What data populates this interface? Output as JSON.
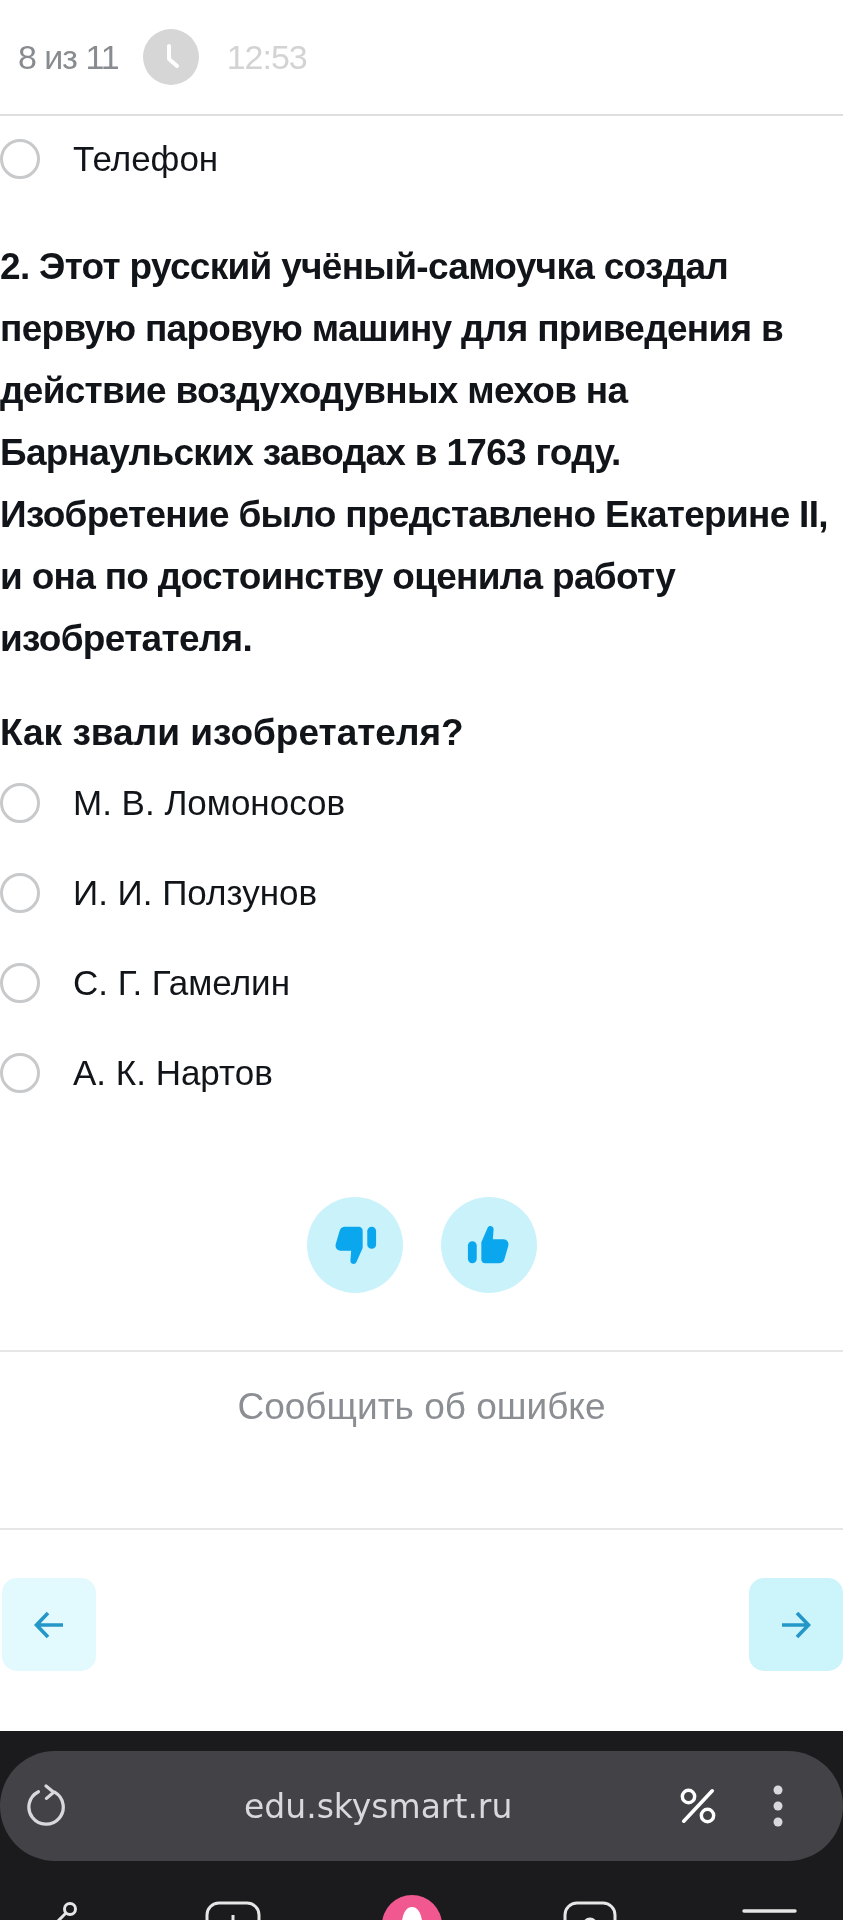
{
  "header": {
    "progress": "8 из 11",
    "timer": "12:53"
  },
  "previous_options": [
    {
      "label": "Телефон",
      "selected": false
    }
  ],
  "question": {
    "text": "2. Этот русский учёный-самоучка создал первую паровую машину для приведения в действие воздуходувных мехов на Барнаульских заводах в 1763 году. Изобретение было представлено Екатерине II, и она по достоинству оценила работу изобретателя.",
    "prompt": "Как звали изобретателя?",
    "options": [
      {
        "label": "М. В. Ломоносов",
        "selected": false
      },
      {
        "label": "И. И. Ползунов",
        "selected": false
      },
      {
        "label": "С. Г. Гамелин",
        "selected": false
      },
      {
        "label": "А. К. Нартов",
        "selected": false
      }
    ]
  },
  "report_link": "Сообщить об ошибке",
  "browser": {
    "url": "edu.skysmart.ru"
  }
}
